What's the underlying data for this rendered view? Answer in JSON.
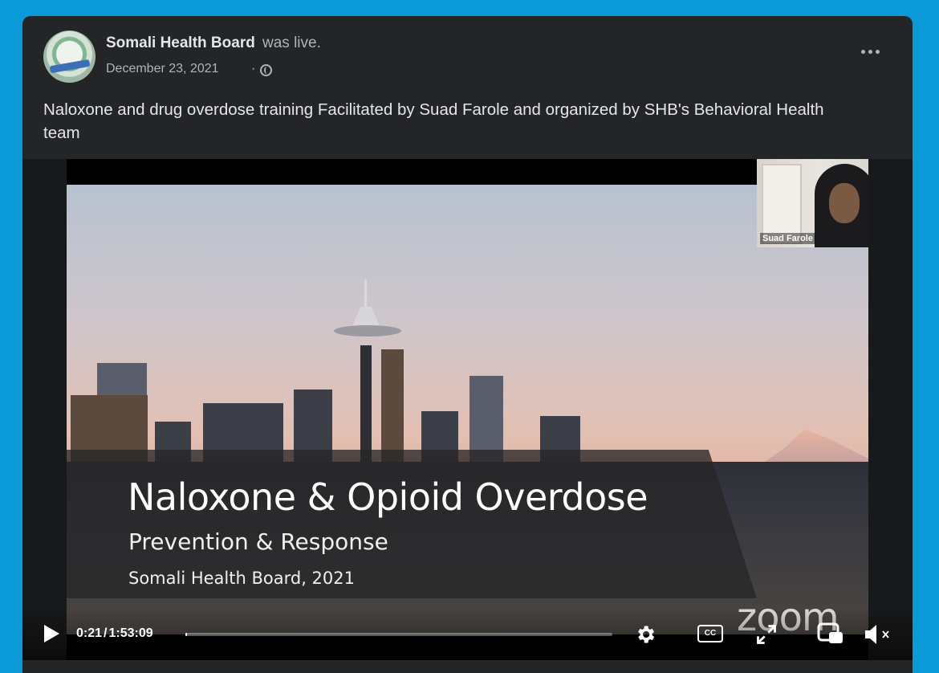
{
  "post": {
    "page_name": "Somali Health Board",
    "status_text": "was live.",
    "date": "December 23, 2021",
    "date_separator": "·",
    "audience_icon": "globe-icon",
    "more_icon": "more-options-icon",
    "caption": "Naloxone and drug overdose training Facilitated by Suad Farole and organized by SHB's Behavioral Health team"
  },
  "video": {
    "slide": {
      "title": "Naloxone & Opioid Overdose",
      "subtitle": "Prevention & Response",
      "organization": "Somali Health Board, 2021"
    },
    "speaker_name": "Suad Farole",
    "watermark": "zoom",
    "controls": {
      "current_time": "0:21",
      "time_separator": "/",
      "duration": "1:53:09",
      "progress_fraction": 0.003,
      "cc_label": "CC",
      "icons": [
        "play-icon",
        "gear-icon",
        "closed-captions-icon",
        "expand-icon",
        "picture-in-picture-icon",
        "mute-icon"
      ]
    }
  },
  "colors": {
    "background": "#0a9ad8",
    "card": "#242526",
    "primary_text": "#e4e6eb",
    "secondary_text": "#b0b3b8"
  }
}
